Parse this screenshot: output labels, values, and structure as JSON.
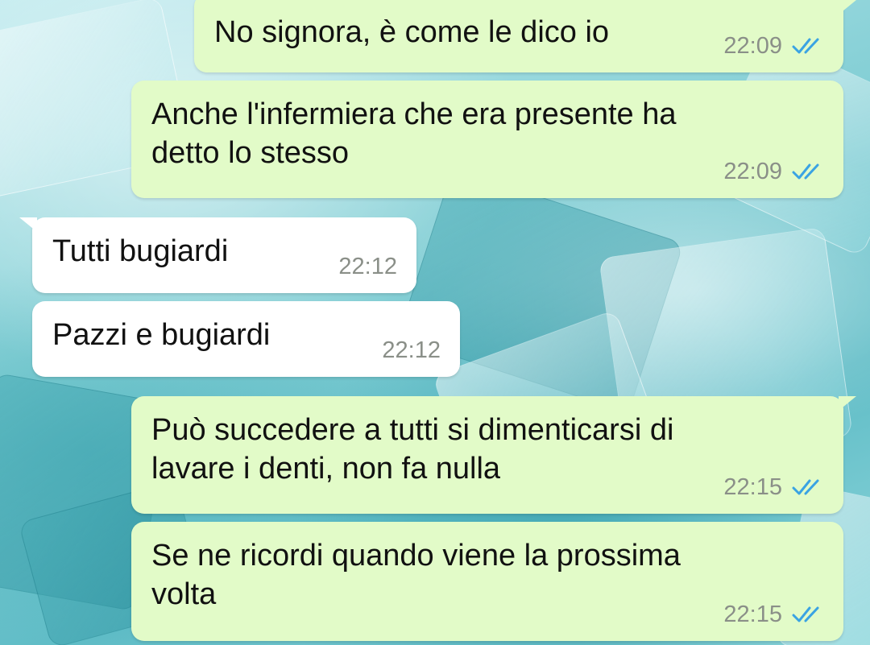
{
  "colors": {
    "outgoing_bubble": "#e2fbc8",
    "incoming_bubble": "#ffffff",
    "read_ticks": "#3aa3e3",
    "timestamp": "#8a8f88"
  },
  "messages": [
    {
      "direction": "outgoing",
      "text": "No signora, è come le dico io",
      "time": "22:09",
      "status_icon": "double-check-read-icon"
    },
    {
      "direction": "outgoing",
      "text": "Anche l'infermiera che era presente ha\ndetto lo stesso",
      "time": "22:09",
      "status_icon": "double-check-read-icon"
    },
    {
      "direction": "incoming",
      "text": "Tutti bugiardi",
      "time": "22:12"
    },
    {
      "direction": "incoming",
      "text": "Pazzi e bugiardi",
      "time": "22:12"
    },
    {
      "direction": "outgoing",
      "text": "Può succedere a tutti si dimenticarsi di\nlavare i denti, non fa nulla",
      "time": "22:15",
      "status_icon": "double-check-read-icon"
    },
    {
      "direction": "outgoing",
      "text": "Se ne ricordi quando viene la prossima\nvolta",
      "time": "22:15",
      "status_icon": "double-check-read-icon"
    }
  ]
}
